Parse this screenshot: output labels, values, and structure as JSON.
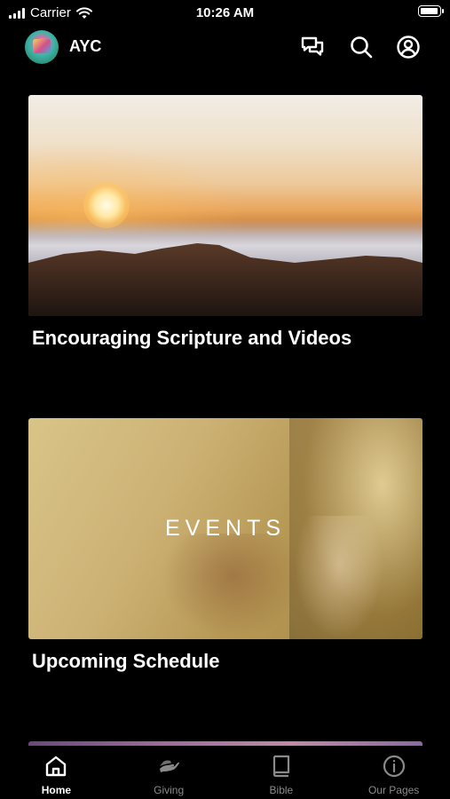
{
  "status_bar": {
    "carrier": "Carrier",
    "time": "10:26 AM",
    "battery_level": 1.0
  },
  "header": {
    "app_name": "AYC"
  },
  "cards": [
    {
      "title": "Encouraging Scripture and Videos"
    },
    {
      "title": "Upcoming Schedule",
      "image_text": "EVENTS"
    }
  ],
  "tabs": [
    {
      "label": "Home",
      "icon": "home-icon",
      "active": true
    },
    {
      "label": "Giving",
      "icon": "giving-hand-icon",
      "active": false
    },
    {
      "label": "Bible",
      "icon": "book-icon",
      "active": false
    },
    {
      "label": "Our Pages",
      "icon": "info-icon",
      "active": false
    }
  ],
  "colors": {
    "background": "#000000",
    "active_tab": "#ffffff",
    "inactive_tab": "#8a8a8a"
  }
}
